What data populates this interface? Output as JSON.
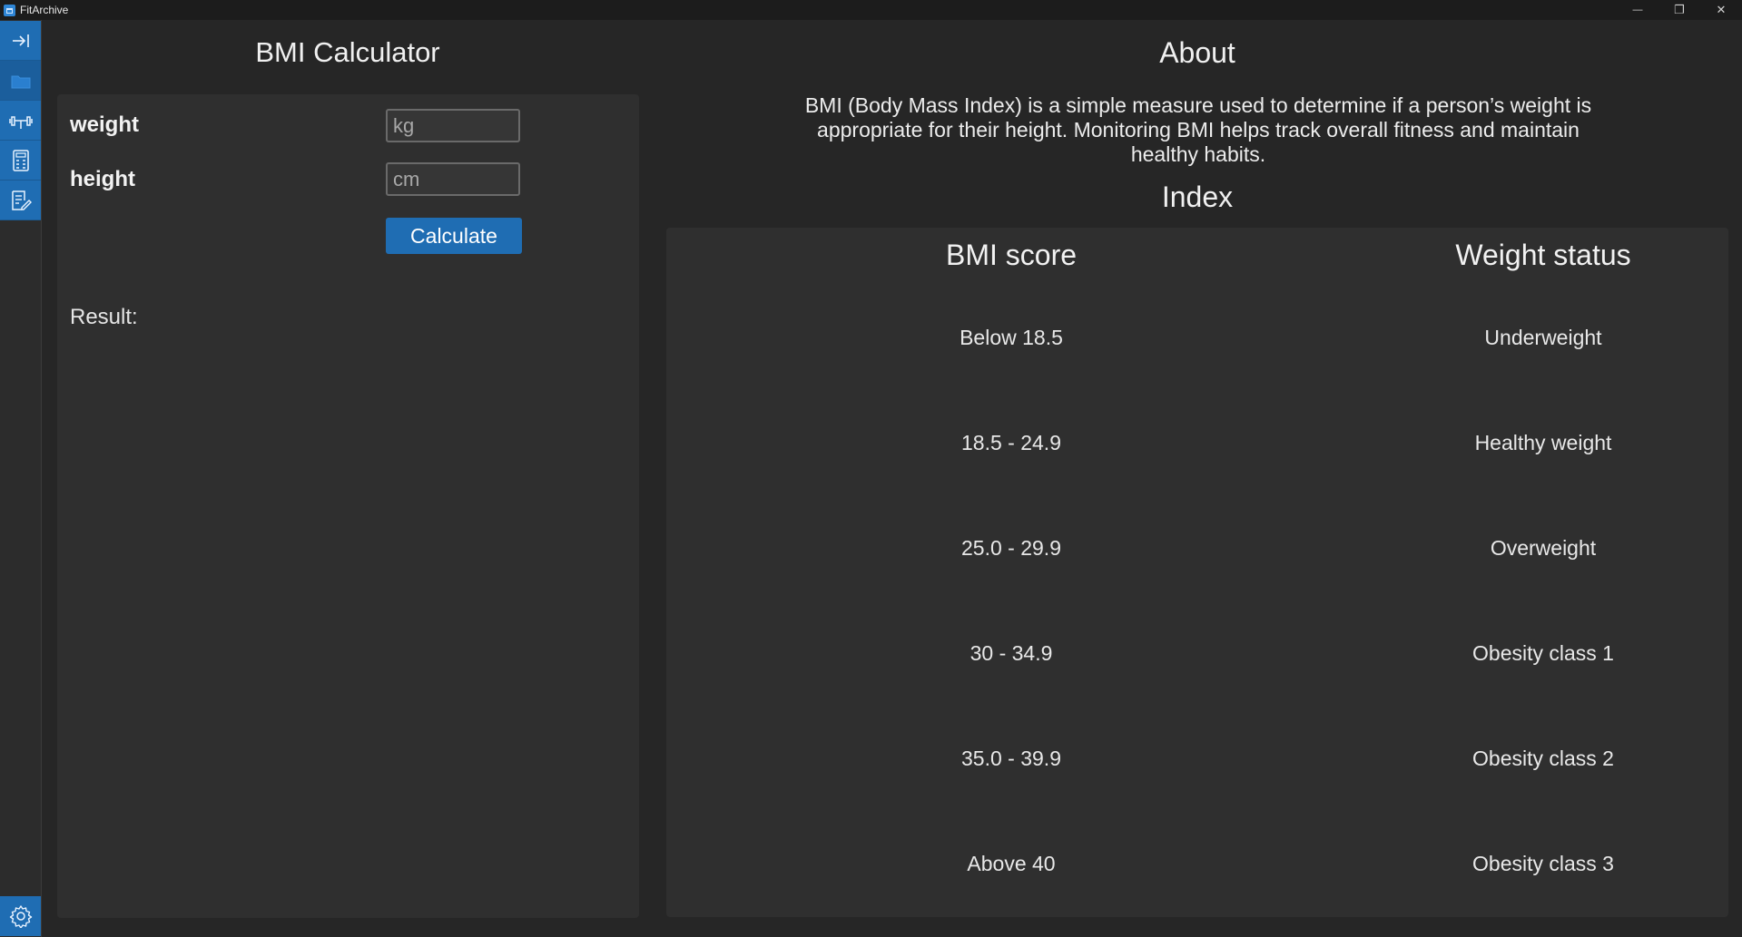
{
  "window": {
    "title": "FitArchive",
    "controls": {
      "minimize": "—",
      "restore": "❐",
      "close": "✕"
    }
  },
  "sidebar": {
    "items": [
      {
        "name": "collapse",
        "icon": "collapse-arrow-icon"
      },
      {
        "name": "folder",
        "icon": "folder-icon"
      },
      {
        "name": "workouts",
        "icon": "dumbbell-icon"
      },
      {
        "name": "calculator",
        "icon": "calculator-icon"
      },
      {
        "name": "notes",
        "icon": "notes-icon"
      }
    ],
    "footer_icon": "gear-icon",
    "accent": "#1f6db3"
  },
  "calculator": {
    "title": "BMI Calculator",
    "weight_label": "weight",
    "weight_placeholder": "kg",
    "height_label": "height",
    "height_placeholder": "cm",
    "button_label": "Calculate",
    "result_label": "Result:"
  },
  "about": {
    "title": "About",
    "text": "BMI (Body Mass Index) is a simple measure used to determine if a person’s weight is appropriate for their height. Monitoring BMI helps track overall fitness and maintain healthy habits."
  },
  "index": {
    "title": "Index",
    "headers": [
      "BMI score",
      "Weight status"
    ],
    "rows": [
      [
        "Below 18.5",
        "Underweight"
      ],
      [
        "18.5 - 24.9",
        "Healthy weight"
      ],
      [
        "25.0 - 29.9",
        "Overweight"
      ],
      [
        "30 - 34.9",
        "Obesity class 1"
      ],
      [
        "35.0 - 39.9",
        "Obesity class 2"
      ],
      [
        "Above 40",
        "Obesity class 3"
      ]
    ]
  }
}
